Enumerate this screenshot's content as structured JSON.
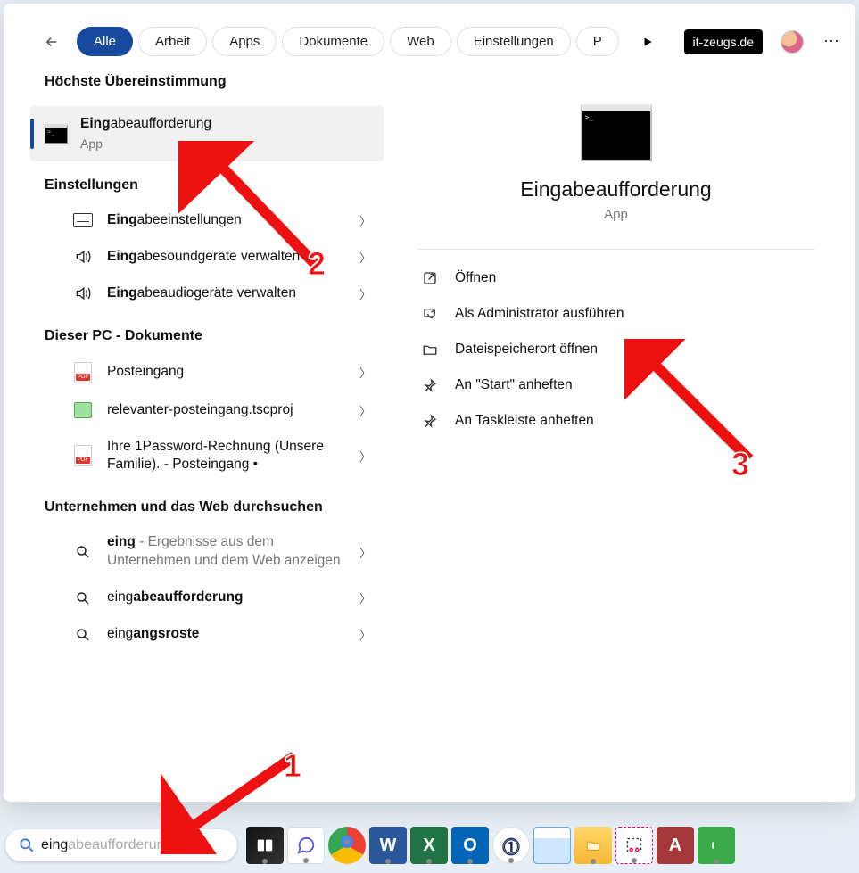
{
  "top": {
    "chips": [
      "Alle",
      "Arbeit",
      "Apps",
      "Dokumente",
      "Web",
      "Einstellungen",
      "P"
    ],
    "active_chip_index": 0,
    "site_label": "it-zeugs.de"
  },
  "sections": {
    "best_match": "Höchste Übereinstimmung",
    "settings": "Einstellungen",
    "documents": "Dieser PC - Dokumente",
    "web": "Unternehmen und das Web durchsuchen"
  },
  "best_match_item": {
    "bold": "Eing",
    "rest": "abeaufforderung",
    "sub": "App"
  },
  "settings_items": [
    {
      "bold": "Eing",
      "rest": "abeeinstellungen",
      "icon": "keyboard"
    },
    {
      "bold": "Eing",
      "rest": "abesoundgeräte verwalten",
      "icon": "speaker"
    },
    {
      "bold": "Eing",
      "rest": "abeaudiogeräte verwalten",
      "icon": "speaker"
    }
  ],
  "document_items": [
    {
      "label": "Posteingang",
      "icon": "pdf"
    },
    {
      "label": "relevanter-posteingang.tscproj",
      "icon": "proj"
    },
    {
      "label": "Ihre 1Password-Rechnung (Unsere Familie). - Posteingang •",
      "icon": "pdf"
    }
  ],
  "web_items": [
    {
      "bold": "eing",
      "rest": "",
      "hint": " - Ergebnisse aus dem Unternehmen und dem Web anzeigen"
    },
    {
      "prefix": "eing",
      "bold": "abeaufforderung"
    },
    {
      "prefix": "eing",
      "bold": "angsroste"
    }
  ],
  "preview": {
    "title": "Eingabeaufforderung",
    "sub": "App",
    "actions": [
      {
        "label": "Öffnen",
        "icon": "open"
      },
      {
        "label": "Als Administrator ausführen",
        "icon": "shield"
      },
      {
        "label": "Dateispeicherort öffnen",
        "icon": "folder"
      },
      {
        "label": "An \"Start\" anheften",
        "icon": "pin"
      },
      {
        "label": "An Taskleiste anheften",
        "icon": "pin"
      }
    ]
  },
  "search": {
    "typed": "eing",
    "ghost": "abeaufforderung"
  },
  "annotations": {
    "n1": "1",
    "n2": "2",
    "n3": "3"
  }
}
